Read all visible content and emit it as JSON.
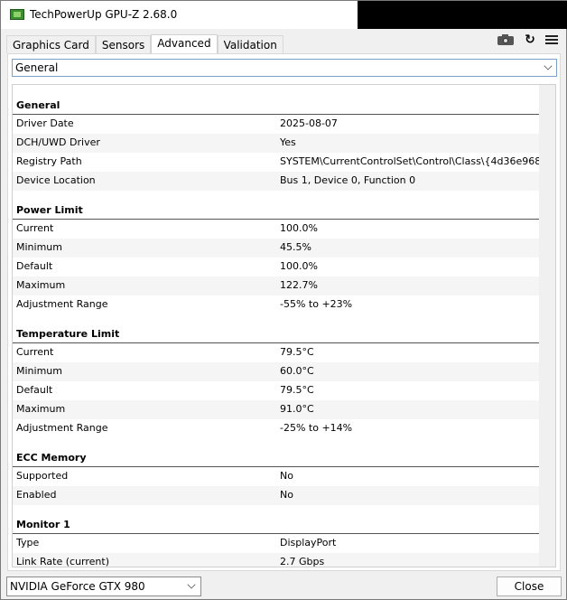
{
  "window": {
    "title": "TechPowerUp GPU-Z 2.68.0"
  },
  "tabs": [
    {
      "label": "Graphics Card"
    },
    {
      "label": "Sensors"
    },
    {
      "label": "Advanced"
    },
    {
      "label": "Validation"
    }
  ],
  "toolbar": {
    "icons": [
      "camera-icon",
      "refresh-icon",
      "menu-icon"
    ]
  },
  "category_select": {
    "value": "General"
  },
  "sections": {
    "general": {
      "title": "General",
      "rows": [
        {
          "key": "Driver Date",
          "value": "2025-08-07"
        },
        {
          "key": "DCH/UWD Driver",
          "value": "Yes"
        },
        {
          "key": "Registry Path",
          "value": "SYSTEM\\CurrentControlSet\\Control\\Class\\{4d36e968-e3"
        },
        {
          "key": "Device Location",
          "value": "Bus 1, Device 0, Function 0"
        }
      ]
    },
    "power": {
      "title": "Power Limit",
      "rows": [
        {
          "key": "Current",
          "value": "100.0%"
        },
        {
          "key": "Minimum",
          "value": "45.5%"
        },
        {
          "key": "Default",
          "value": "100.0%"
        },
        {
          "key": "Maximum",
          "value": "122.7%"
        },
        {
          "key": "Adjustment Range",
          "value": "-55% to +23%"
        }
      ]
    },
    "temp": {
      "title": "Temperature Limit",
      "rows": [
        {
          "key": "Current",
          "value": "79.5°C"
        },
        {
          "key": "Minimum",
          "value": "60.0°C"
        },
        {
          "key": "Default",
          "value": "79.5°C"
        },
        {
          "key": "Maximum",
          "value": "91.0°C"
        },
        {
          "key": "Adjustment Range",
          "value": "-25% to +14%"
        }
      ]
    },
    "ecc": {
      "title": "ECC Memory",
      "rows": [
        {
          "key": "Supported",
          "value": "No"
        },
        {
          "key": "Enabled",
          "value": "No"
        }
      ]
    },
    "monitor": {
      "title": "Monitor 1",
      "rows": [
        {
          "key": "Type",
          "value": "DisplayPort"
        },
        {
          "key": "Link Rate (current)",
          "value": "2.7 Gbps"
        }
      ]
    }
  },
  "footer": {
    "gpu_select": "NVIDIA GeForce GTX 980",
    "close_label": "Close"
  }
}
